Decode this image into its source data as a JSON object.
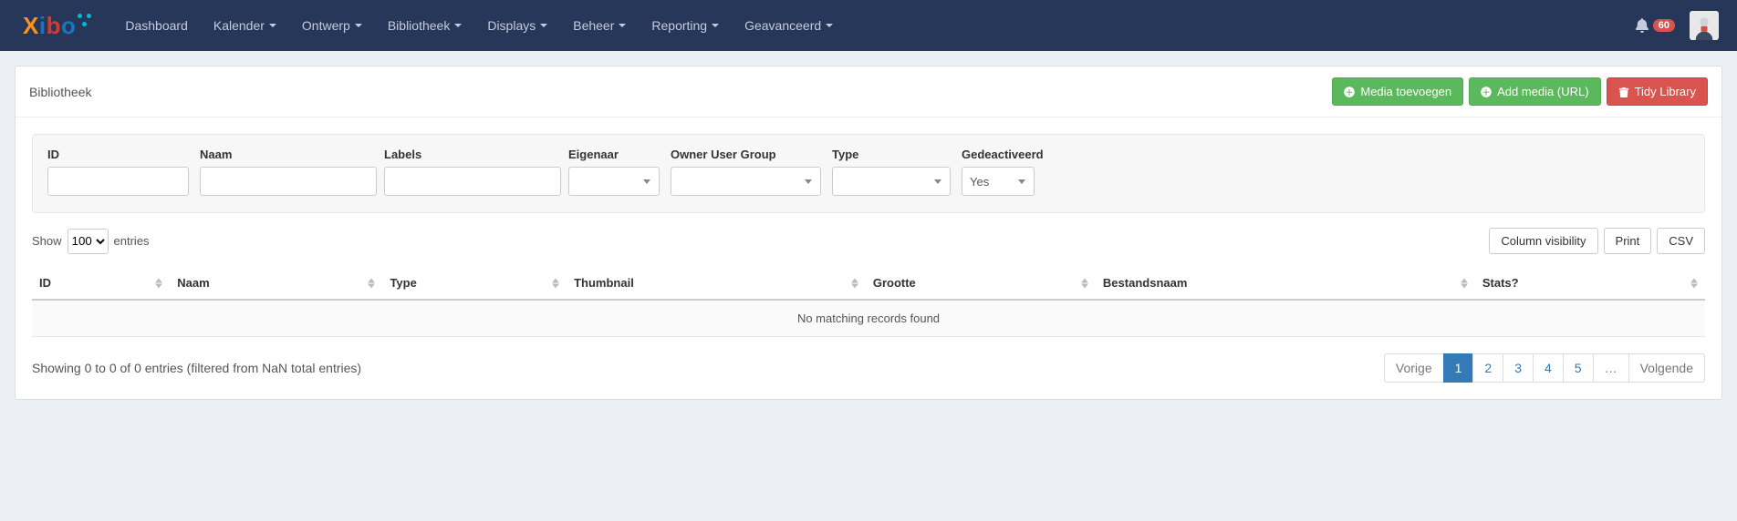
{
  "nav": {
    "items": [
      {
        "label": "Dashboard",
        "has_dropdown": false
      },
      {
        "label": "Kalender",
        "has_dropdown": true
      },
      {
        "label": "Ontwerp",
        "has_dropdown": true
      },
      {
        "label": "Bibliotheek",
        "has_dropdown": true
      },
      {
        "label": "Displays",
        "has_dropdown": true
      },
      {
        "label": "Beheer",
        "has_dropdown": true
      },
      {
        "label": "Reporting",
        "has_dropdown": true
      },
      {
        "label": "Geavanceerd",
        "has_dropdown": true
      }
    ],
    "notification_count": "60"
  },
  "page": {
    "title": "Bibliotheek",
    "actions": {
      "add_media": "Media toevoegen",
      "add_media_url": "Add media (URL)",
      "tidy_library": "Tidy Library"
    }
  },
  "filters": {
    "id": {
      "label": "ID",
      "value": ""
    },
    "name": {
      "label": "Naam",
      "value": ""
    },
    "labels": {
      "label": "Labels",
      "value": ""
    },
    "owner": {
      "label": "Eigenaar",
      "value": ""
    },
    "ownergroup": {
      "label": "Owner User Group",
      "value": ""
    },
    "type": {
      "label": "Type",
      "value": ""
    },
    "retired": {
      "label": "Gedeactiveerd",
      "value": "Yes"
    }
  },
  "datatable": {
    "length": {
      "prefix": "Show",
      "value": "100",
      "suffix": "entries"
    },
    "buttons": {
      "colvis": "Column visibility",
      "print": "Print",
      "csv": "CSV"
    },
    "columns": [
      "ID",
      "Naam",
      "Type",
      "Thumbnail",
      "Grootte",
      "Bestandsnaam",
      "Stats?"
    ],
    "empty": "No matching records found",
    "info": "Showing 0 to 0 of 0 entries (filtered from NaN total entries)",
    "pagination": {
      "prev": "Vorige",
      "next": "Volgende",
      "pages": [
        "1",
        "2",
        "3",
        "4",
        "5",
        "…"
      ],
      "active_index": 0
    }
  }
}
